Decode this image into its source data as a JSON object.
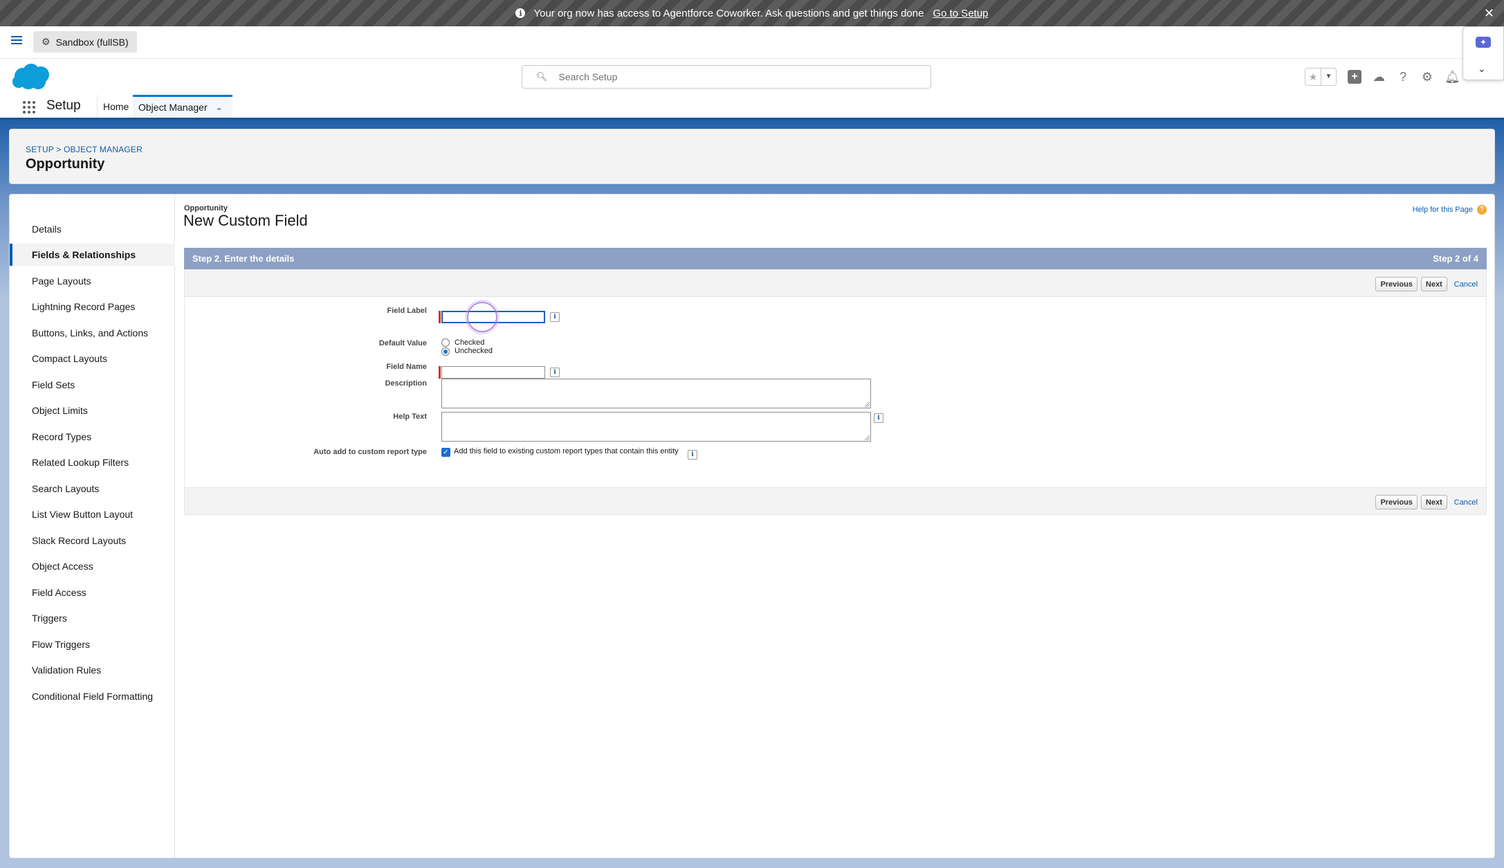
{
  "banner": {
    "message": "Your org now has access to Agentforce Coworker. Ask questions and get things done",
    "link": "Go to Setup"
  },
  "org": {
    "name": "Sandbox (fullSB)"
  },
  "search": {
    "placeholder": "Search Setup"
  },
  "app": {
    "name": "Setup",
    "nav": {
      "home": "Home",
      "object_manager": "Object Manager"
    }
  },
  "page_header": {
    "breadcrumb": "SETUP > OBJECT MANAGER",
    "title": "Opportunity"
  },
  "sidebar": {
    "items": [
      "Details",
      "Fields & Relationships",
      "Page Layouts",
      "Lightning Record Pages",
      "Buttons, Links, and Actions",
      "Compact Layouts",
      "Field Sets",
      "Object Limits",
      "Record Types",
      "Related Lookup Filters",
      "Search Layouts",
      "List View Button Layout",
      "Slack Record Layouts",
      "Object Access",
      "Field Access",
      "Triggers",
      "Flow Triggers",
      "Validation Rules",
      "Conditional Field Formatting"
    ],
    "active": "Fields & Relationships"
  },
  "content": {
    "object_label": "Opportunity",
    "title": "New Custom Field",
    "help_link": "Help for this Page",
    "step_title": "Step 2. Enter the details",
    "step_count": "Step 2 of 4",
    "buttons": {
      "previous": "Previous",
      "next": "Next",
      "cancel": "Cancel"
    }
  },
  "form": {
    "field_label": {
      "label": "Field Label",
      "value": ""
    },
    "default_value": {
      "label": "Default Value",
      "options": [
        "Checked",
        "Unchecked"
      ],
      "selected": "Unchecked"
    },
    "field_name": {
      "label": "Field Name",
      "value": ""
    },
    "description": {
      "label": "Description",
      "value": ""
    },
    "help_text": {
      "label": "Help Text",
      "value": ""
    },
    "auto_add": {
      "label": "Auto add to custom report type",
      "checkbox_label": "Add this field to existing custom report types that contain this entity",
      "checked": true
    }
  },
  "colors": {
    "brand_blue": "#0b5cab",
    "step_bar": "#8ca1c4",
    "required": "#c23934"
  }
}
